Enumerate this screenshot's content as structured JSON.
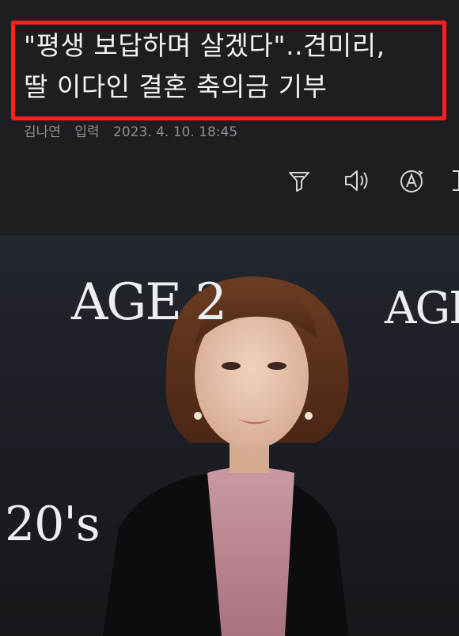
{
  "article": {
    "headline_line1": "\"평생 보답하며 살겠다\"..견미리,",
    "headline_line2": "딸 이다인 결혼 축의금 기부",
    "author": "김나연",
    "input_label": "입력",
    "timestamp": "2023. 4. 10. 18:45"
  },
  "toolbar": {
    "icons": [
      "summary-icon",
      "speaker-icon",
      "translate-icon",
      "more-icon"
    ]
  },
  "photo": {
    "backdrop_text_1": "AGE 2",
    "backdrop_text_2": "AGE",
    "backdrop_text_3": "20's"
  },
  "colors": {
    "highlight": "#ff1f1f",
    "background": "#1d1e22"
  }
}
